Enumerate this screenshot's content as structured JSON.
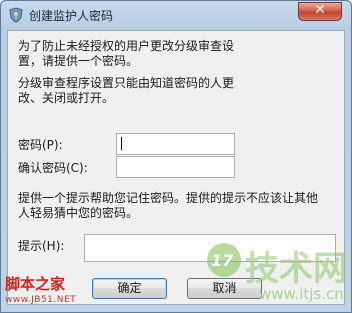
{
  "window": {
    "title": "创建监护人密码",
    "close_glyph": "✕"
  },
  "content": {
    "intro_line1": "为了防止未经授权的用户更改分级审查设",
    "intro_line2": "置，请提供一个密码。",
    "info_line1": "分级审查程序设置只能由知道密码的人更",
    "info_line2": "改、关闭或打开。",
    "password_label": "密码(P):",
    "password_value": "",
    "confirm_label": "确认密码(C):",
    "confirm_value": "",
    "hint_desc_line1": "提供一个提示帮助您记住密码。提供的提示不应该让其他",
    "hint_desc_line2": "人轻易猜中您的密码。",
    "hint_label": "提示(H):",
    "hint_value": ""
  },
  "buttons": {
    "ok": "确定",
    "cancel": "取消"
  },
  "watermarks": {
    "left_text": "脚本之家",
    "left_url": "www.JB51.NET",
    "right_logo_num": "17",
    "right_text": "技术网",
    "right_url": "www.itjs.cn"
  },
  "colors": {
    "close_button": "#c4432e",
    "title_bar": "#b6cde3",
    "watermark_green": "#8ec76a",
    "watermark_red": "#d2231b"
  },
  "icons": {
    "title": "shield-key-icon",
    "close": "close-icon"
  }
}
